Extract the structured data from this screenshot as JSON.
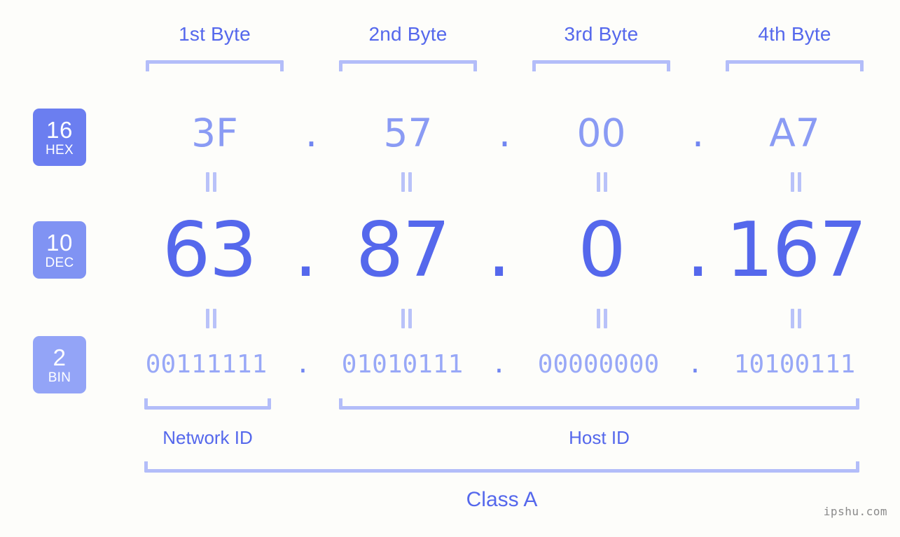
{
  "background_color": "#fdfdfa",
  "accent_colors": {
    "strong_blue": "#5568ec",
    "mid_blue": "#8a9bf4",
    "light_blue": "#b3bdf9",
    "badge_hex": "#6b7ef0",
    "badge_dec": "#8093f3",
    "badge_bin": "#93a4f7",
    "watermark_gray": "#8a8a8a"
  },
  "byte_headers": [
    {
      "label": "1st Byte"
    },
    {
      "label": "2nd Byte"
    },
    {
      "label": "3rd Byte"
    },
    {
      "label": "4th Byte"
    }
  ],
  "bases": [
    {
      "number": "16",
      "name": "HEX"
    },
    {
      "number": "10",
      "name": "DEC"
    },
    {
      "number": "2",
      "name": "BIN"
    }
  ],
  "rows": {
    "hex": {
      "base_number": "16",
      "base_name": "HEX",
      "values": [
        "3F",
        "57",
        "00",
        "A7"
      ],
      "separator": "."
    },
    "dec": {
      "base_number": "10",
      "base_name": "DEC",
      "values": [
        "63",
        "87",
        "0",
        "167"
      ],
      "separator": "."
    },
    "bin": {
      "base_number": "2",
      "base_name": "BIN",
      "values": [
        "00111111",
        "01010111",
        "00000000",
        "10100111"
      ],
      "separator": "."
    }
  },
  "equals_marks": {
    "glyph": "=",
    "count_per_gap": 4,
    "gaps": [
      "hex-to-dec",
      "dec-to-bin"
    ]
  },
  "segments": {
    "network_id": "Network ID",
    "host_id": "Host ID",
    "class": "Class A"
  },
  "watermark": "ipshu.com",
  "ip_address": {
    "dotted_decimal": "63.87.0.167",
    "dotted_hex": "3F.57.00.A7",
    "dotted_binary": "00111111.01010111.00000000.10100111"
  }
}
